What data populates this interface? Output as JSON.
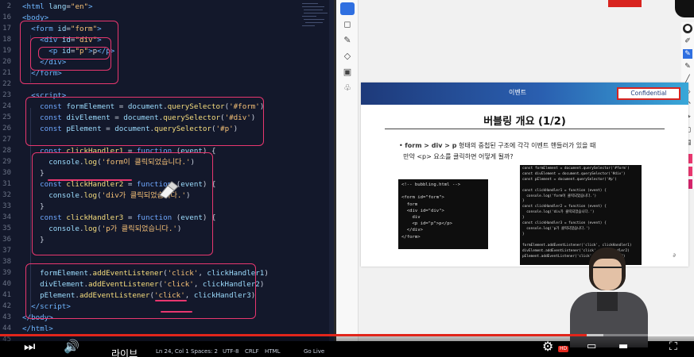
{
  "editor": {
    "line_numbers": [
      "2",
      "16",
      "17",
      "18",
      "19",
      "20",
      "21",
      "22",
      "23",
      "24",
      "25",
      "26",
      "27",
      "28",
      "29",
      "30",
      "31",
      "32",
      "33",
      "34",
      "35",
      "36",
      "37",
      "38",
      "39",
      "40",
      "41",
      "42",
      "43",
      "44",
      "45",
      "46"
    ]
  },
  "status_bar": {
    "position": "Ln 24, Col 1",
    "spaces": "Spaces: 2",
    "encoding": "UTF-8",
    "eol": "CRLF",
    "language": "HTML",
    "go_live": "Go Live"
  },
  "slide": {
    "section": "이벤트",
    "confidential": "Confidential",
    "title": "버블링 개요 (1/2)",
    "bullet_part1": "form > div > p",
    "bullet_part2": " 형태의 중첩된 구조에 각각 이벤트 핸들러가 있을 때",
    "bullet_line2": "만약 <p> 요소를 클릭하면 어떻게 될까?",
    "code_html": "<!-- bubbling.html -->\n\n<form id=\"form\">\n  form\n  <div id=\"div\">\n    div\n    <p id=\"p\">p</p>\n  </div>\n</form>",
    "code_js": "const formElement = document.querySelector('#form')\nconst divElement = document.querySelector('#div')\nconst pElement = document.querySelector('#p')\n\nconst clickHandler1 = function (event) {\n  console.log('form이 클릭되었습니다.')\n}\nconst clickHandler2 = function (event) {\n  console.log('div가 클릭되었습니다.')\n}\nconst clickHandler3 = function (event) {\n  console.log('p가 클릭되었습니다.')\n}\n\nformElement.addEventListener('click', clickHandler1)\ndivElement.addEventListener('click', clickHandler2)\npElement.addEventListener('click', clickHandler3)",
    "page_marker": "∂"
  },
  "player": {
    "live_label": "라이브",
    "hd_badge": "HD",
    "progress_fraction": 0.845,
    "buffer_fraction": 0.87
  }
}
